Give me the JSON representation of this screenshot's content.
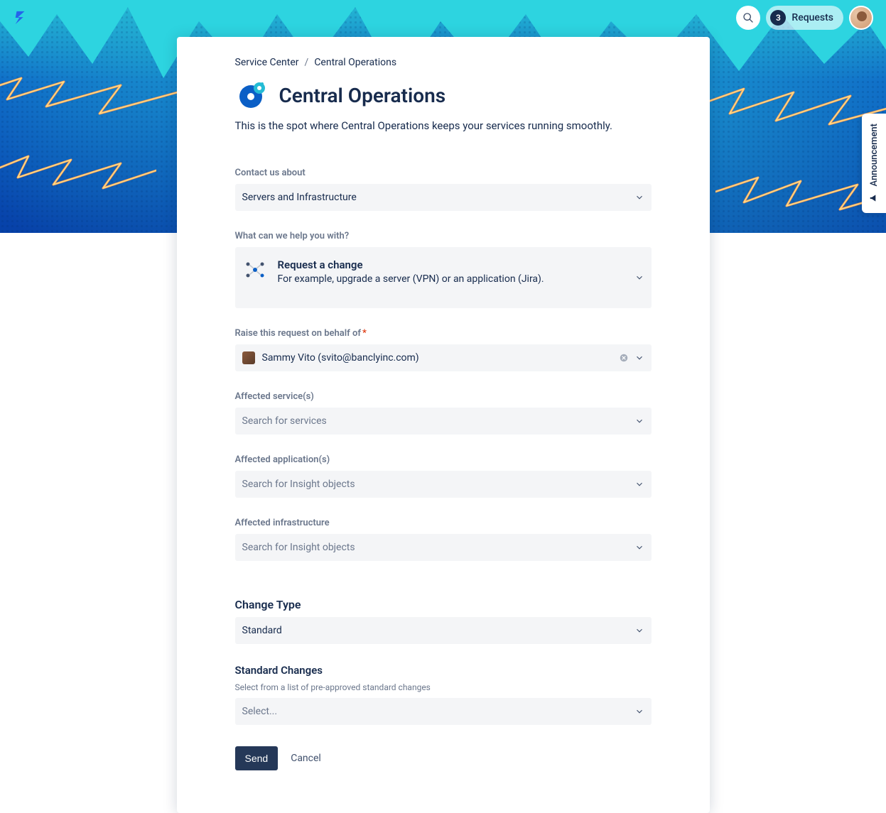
{
  "header": {
    "requests_label": "Requests",
    "requests_count": "3"
  },
  "announcement": {
    "label": "Announcement"
  },
  "breadcrumb": {
    "service_center": "Service Center",
    "current": "Central Operations"
  },
  "page": {
    "title": "Central Operations",
    "description": "This is the spot where Central Operations keeps your services running smoothly."
  },
  "form": {
    "contact_label": "Contact us about",
    "contact_value": "Servers and Infrastructure",
    "help_label": "What can we help you with?",
    "help_option_title": "Request a change",
    "help_option_desc": "For example, upgrade a server (VPN) or an application (Jira).",
    "behalf_label": "Raise this request on behalf of",
    "behalf_value": "Sammy Vito (svito@banclyinc.com)",
    "services_label": "Affected service(s)",
    "services_placeholder": "Search for services",
    "apps_label": "Affected application(s)",
    "apps_placeholder": "Search for Insight objects",
    "infra_label": "Affected infrastructure",
    "infra_placeholder": "Search for Insight objects",
    "change_type_label": "Change Type",
    "change_type_value": "Standard",
    "std_changes_label": "Standard Changes",
    "std_changes_help": "Select from a list of pre-approved standard changes",
    "std_changes_placeholder": "Select...",
    "send": "Send",
    "cancel": "Cancel"
  }
}
